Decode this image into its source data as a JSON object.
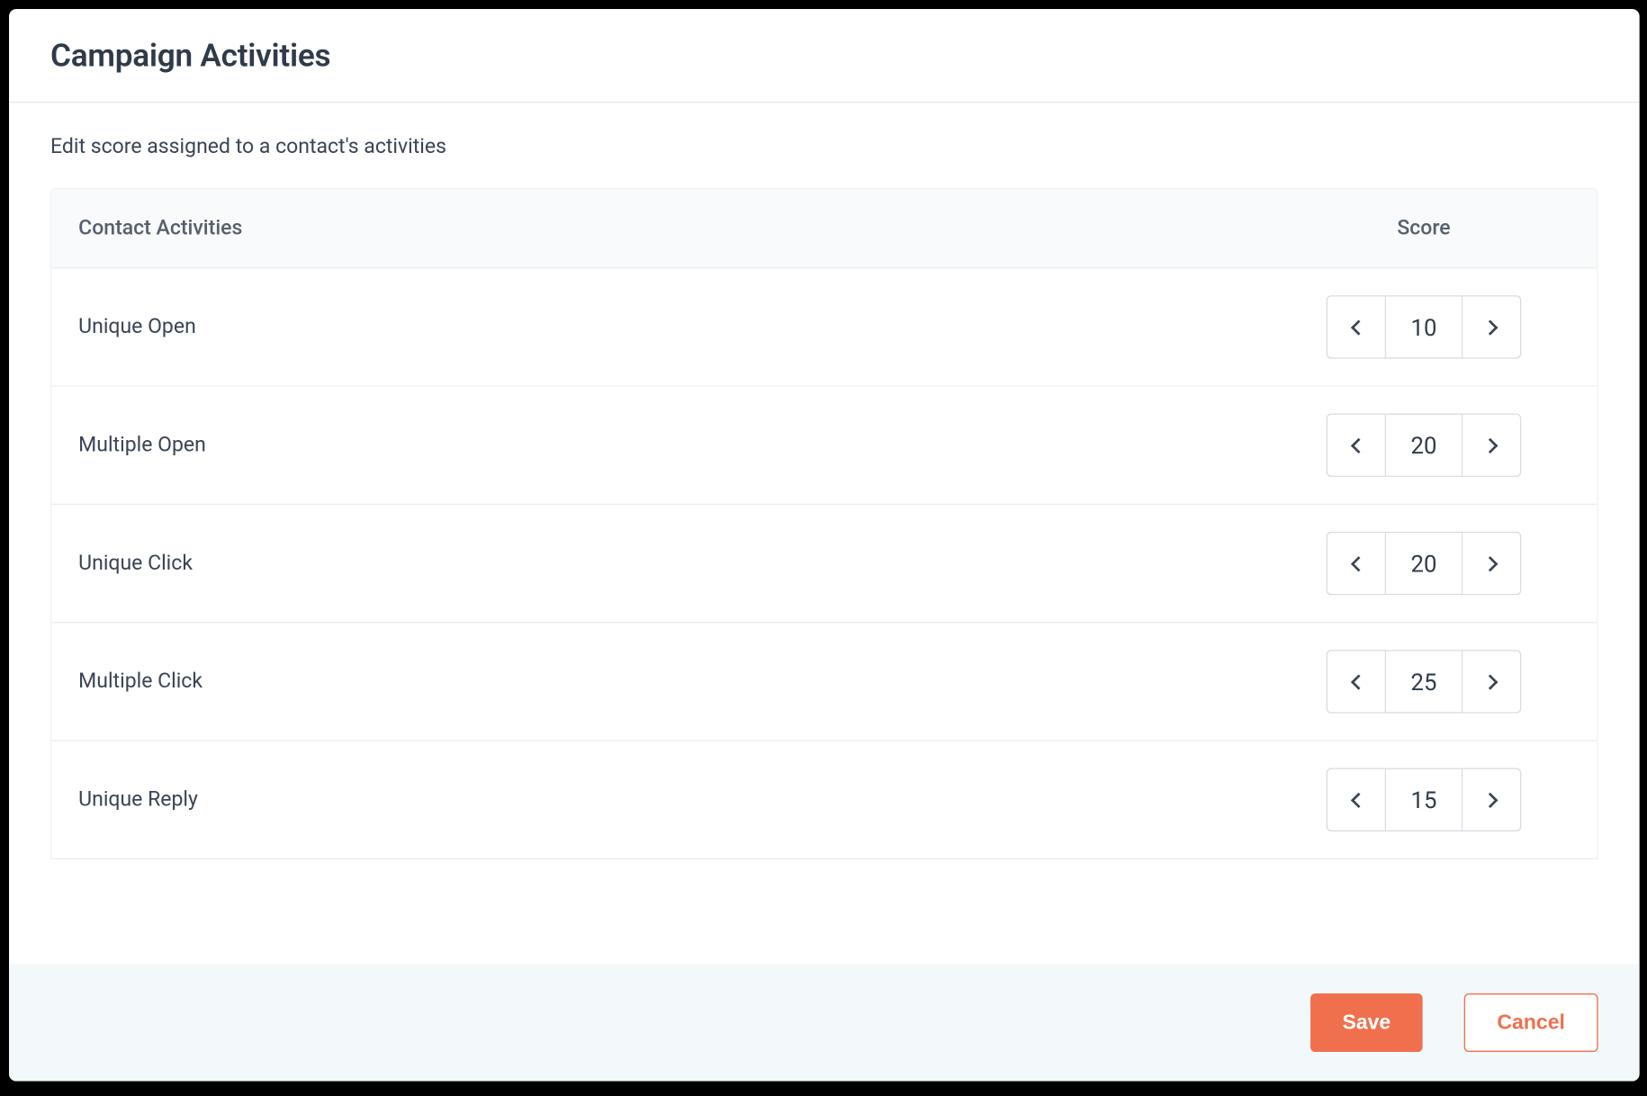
{
  "header": {
    "title": "Campaign Activities"
  },
  "subtitle": "Edit score assigned to a contact's activities",
  "table": {
    "columns": {
      "activity": "Contact Activities",
      "score": "Score"
    },
    "rows": [
      {
        "label": "Unique Open",
        "value": "10"
      },
      {
        "label": "Multiple Open",
        "value": "20"
      },
      {
        "label": "Unique Click",
        "value": "20"
      },
      {
        "label": "Multiple Click",
        "value": "25"
      },
      {
        "label": "Unique Reply",
        "value": "15"
      }
    ]
  },
  "footer": {
    "save": "Save",
    "cancel": "Cancel"
  }
}
